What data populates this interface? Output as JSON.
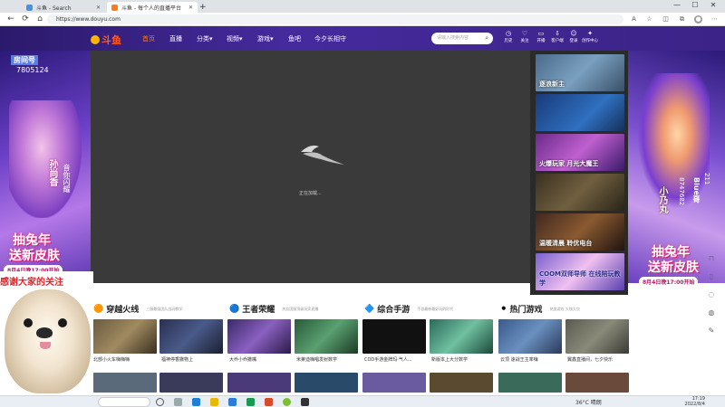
{
  "browser": {
    "tabs": [
      {
        "title": "斗鱼 - Search",
        "active": false
      },
      {
        "title": "斗鱼 - 每个人的直播平台",
        "active": true
      }
    ],
    "new_tab": "+",
    "url": "https://www.douyu.com",
    "window_controls": [
      "—",
      "☐",
      "✕"
    ]
  },
  "site": {
    "logo": "斗鱼",
    "nav": [
      "首页",
      "直播",
      "分类",
      "视频",
      "游戏",
      "鱼吧",
      "今夕长相守"
    ],
    "search_placeholder": "请输入搜索内容",
    "header_icons": [
      "历史",
      "关注",
      "开播",
      "客户端",
      "登录",
      "创作中心"
    ]
  },
  "left_banner": {
    "room_label": "房间号",
    "room_id": "7805124",
    "name": "孙尚香",
    "subtitle": "音你闪耀",
    "promo1": "抽兔年",
    "promo2": "送新皮肤",
    "date": "8月4日晚17:00开始"
  },
  "right_banner": {
    "name": "小乃丸",
    "id": "8747682",
    "label": "Blue哥",
    "num": "211",
    "promo1": "抽兔年",
    "promo2": "送新皮肤",
    "date": "8月4日晚17:00开始"
  },
  "player": {
    "loading_text": "正在加载..."
  },
  "playlist": [
    {
      "title": "逐浪新主"
    },
    {
      "title": ""
    },
    {
      "title": "火爆玩家 月光大魔王"
    },
    {
      "title": ""
    },
    {
      "title": "温暖清晨 聆优电台"
    },
    {
      "title": "COOM双师导师 在线陪玩教学"
    }
  ],
  "categories": [
    {
      "icon": "🟠",
      "title": "穿越火线",
      "sub": "三服最强团队战玩教学"
    },
    {
      "icon": "🔵",
      "title": "王者荣耀",
      "sub": "热血国服顶级玩家直播"
    },
    {
      "icon": "🔷",
      "title": "综合手游",
      "sub": "手游最新最好玩的时代"
    },
    {
      "icon": "⚫",
      "title": "热门游戏",
      "sub": "热血游戏 大咖大包"
    }
  ],
  "cards": [
    {
      "label": "北部小火车嗨嗨嗨"
    },
    {
      "label": "福神停香撒物上"
    },
    {
      "label": "大乔小乔撒嘴"
    },
    {
      "label": "米莱迪嗨唱发射数学"
    },
    {
      "label": "COD手游金牌玛·气人..."
    },
    {
      "label": "新版本上大分数学"
    },
    {
      "label": "云顶 速战王主率嗨"
    },
    {
      "label": "翼鑫直播间，七夕快乐"
    }
  ],
  "dog_caption": "感谢大家的关注",
  "taskbar": {
    "weather": "36°C 晴朗",
    "time": "17:19",
    "date": "2022/8/4"
  }
}
